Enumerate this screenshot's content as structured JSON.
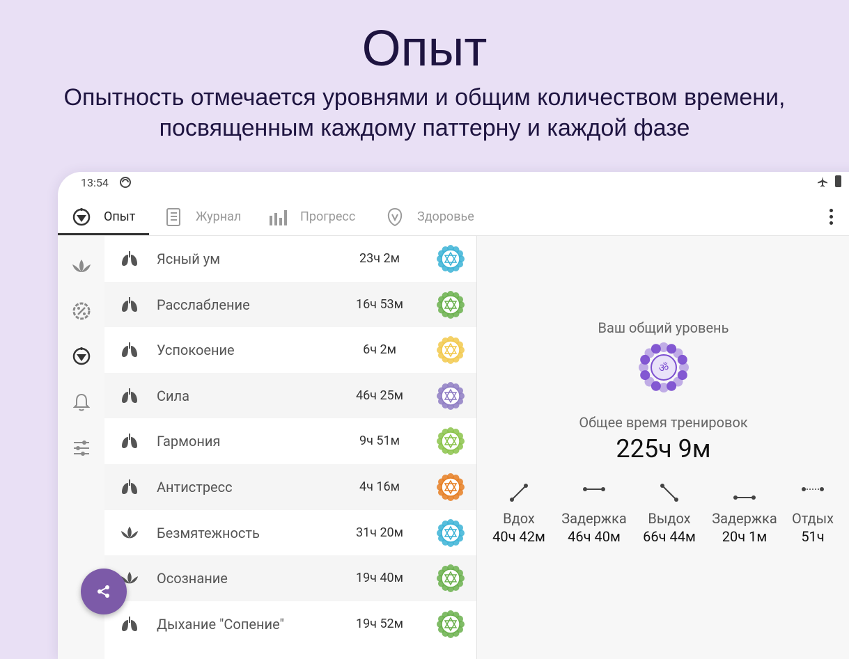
{
  "hero": {
    "title": "Опыт",
    "subtitle_line1": "Опытность отмечается уровнями и общим количеством времени,",
    "subtitle_line2": "посвященным каждому паттерну и каждой фазе"
  },
  "status": {
    "time": "13:54"
  },
  "tabs": [
    {
      "label": "Опыт",
      "icon": "chakra-emblem-icon",
      "active": true
    },
    {
      "label": "Журнал",
      "icon": "journal-icon",
      "active": false
    },
    {
      "label": "Прогресс",
      "icon": "bar-chart-icon",
      "active": false
    },
    {
      "label": "Здоровье",
      "icon": "health-icon",
      "active": false
    }
  ],
  "rail": [
    "lotus-icon",
    "percent-badge-icon",
    "chakra-emblem-icon",
    "bell-icon",
    "sliders-icon"
  ],
  "patterns": [
    {
      "name": "Ясный ум",
      "time": "23ч 2м",
      "icon": "lungs-icon",
      "chakra_color": "#3bb3d6"
    },
    {
      "name": "Расслабление",
      "time": "16ч 53м",
      "icon": "lungs-icon",
      "chakra_color": "#6ab04c"
    },
    {
      "name": "Успокоение",
      "time": "6ч 2м",
      "icon": "lungs-icon",
      "chakra_color": "#f2c94c"
    },
    {
      "name": "Сила",
      "time": "46ч 25м",
      "icon": "lungs-icon",
      "chakra_color": "#8e7cc3"
    },
    {
      "name": "Гармония",
      "time": "9ч 51м",
      "icon": "lungs-icon",
      "chakra_color": "#8bc34a"
    },
    {
      "name": "Антистресс",
      "time": "4ч 16м",
      "icon": "lungs-icon",
      "chakra_color": "#e67e22"
    },
    {
      "name": "Безмятежность",
      "time": "31ч 20м",
      "icon": "lotus-icon",
      "chakra_color": "#3bb3d6"
    },
    {
      "name": "Осознание",
      "time": "19ч 40м",
      "icon": "lotus-icon",
      "chakra_color": "#6ab04c"
    },
    {
      "name": "Дыхание \"Сопение\"",
      "time": "19ч 52м",
      "icon": "lungs-icon",
      "chakra_color": "#6ab04c"
    }
  ],
  "detail": {
    "level_label": "Ваш общий уровень",
    "total_label": "Общее время тренировок",
    "total_value": "225ч 9м",
    "phases": [
      {
        "label": "Вдох",
        "value": "40ч 42м",
        "icon": "inhale-icon"
      },
      {
        "label": "Задержка",
        "value": "46ч 40м",
        "icon": "hold-icon"
      },
      {
        "label": "Выдох",
        "value": "66ч 44м",
        "icon": "exhale-icon"
      },
      {
        "label": "Задержка",
        "value": "20ч 1м",
        "icon": "hold-icon"
      },
      {
        "label": "Отдых",
        "value": "51ч",
        "icon": "rest-icon"
      }
    ]
  },
  "colors": {
    "background": "#e9e0f5",
    "accent": "#7c5aa8",
    "crown_chakra": "#7c4fd0"
  }
}
